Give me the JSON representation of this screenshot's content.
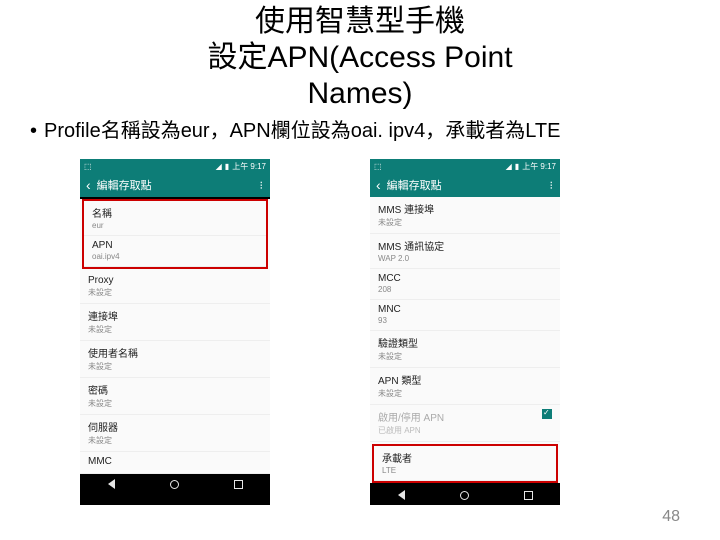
{
  "title_l1": "使用智慧型手機",
  "title_l2a": "設定",
  "title_l2b": "APN(Access Point",
  "title_l3": "Names)",
  "bullet": "Profile名稱設為eur，APN欄位設為oai. ipv4，承載者為LTE",
  "status_time": "上午 9:17",
  "appbar_title": "編輯存取點",
  "left": {
    "r1": {
      "lbl": "名稱",
      "val": "eur"
    },
    "r2": {
      "lbl": "APN",
      "val": "oai.ipv4"
    },
    "r3": {
      "lbl": "Proxy",
      "val": "未設定"
    },
    "r4": {
      "lbl": "連接埠",
      "val": "未設定"
    },
    "r5": {
      "lbl": "使用者名稱",
      "val": "未設定"
    },
    "r6": {
      "lbl": "密碼",
      "val": "未設定"
    },
    "r7": {
      "lbl": "伺服器",
      "val": "未設定"
    },
    "r8": {
      "lbl": "MMC",
      "val": ""
    }
  },
  "right": {
    "r1": {
      "lbl": "MMS 連接埠",
      "val": "未設定"
    },
    "r2": {
      "lbl": "MMS 通訊協定",
      "val": "WAP 2.0"
    },
    "r3": {
      "lbl": "MCC",
      "val": "208"
    },
    "r4": {
      "lbl": "MNC",
      "val": "93"
    },
    "r5": {
      "lbl": "驗證類型",
      "val": "未設定"
    },
    "r6": {
      "lbl": "APN 類型",
      "val": "未設定"
    },
    "r7": {
      "lbl": "啟用/停用 APN",
      "val": "已啟用 APN"
    },
    "r8": {
      "lbl": "承載者",
      "val": "LTE"
    }
  },
  "pagenum": "48"
}
